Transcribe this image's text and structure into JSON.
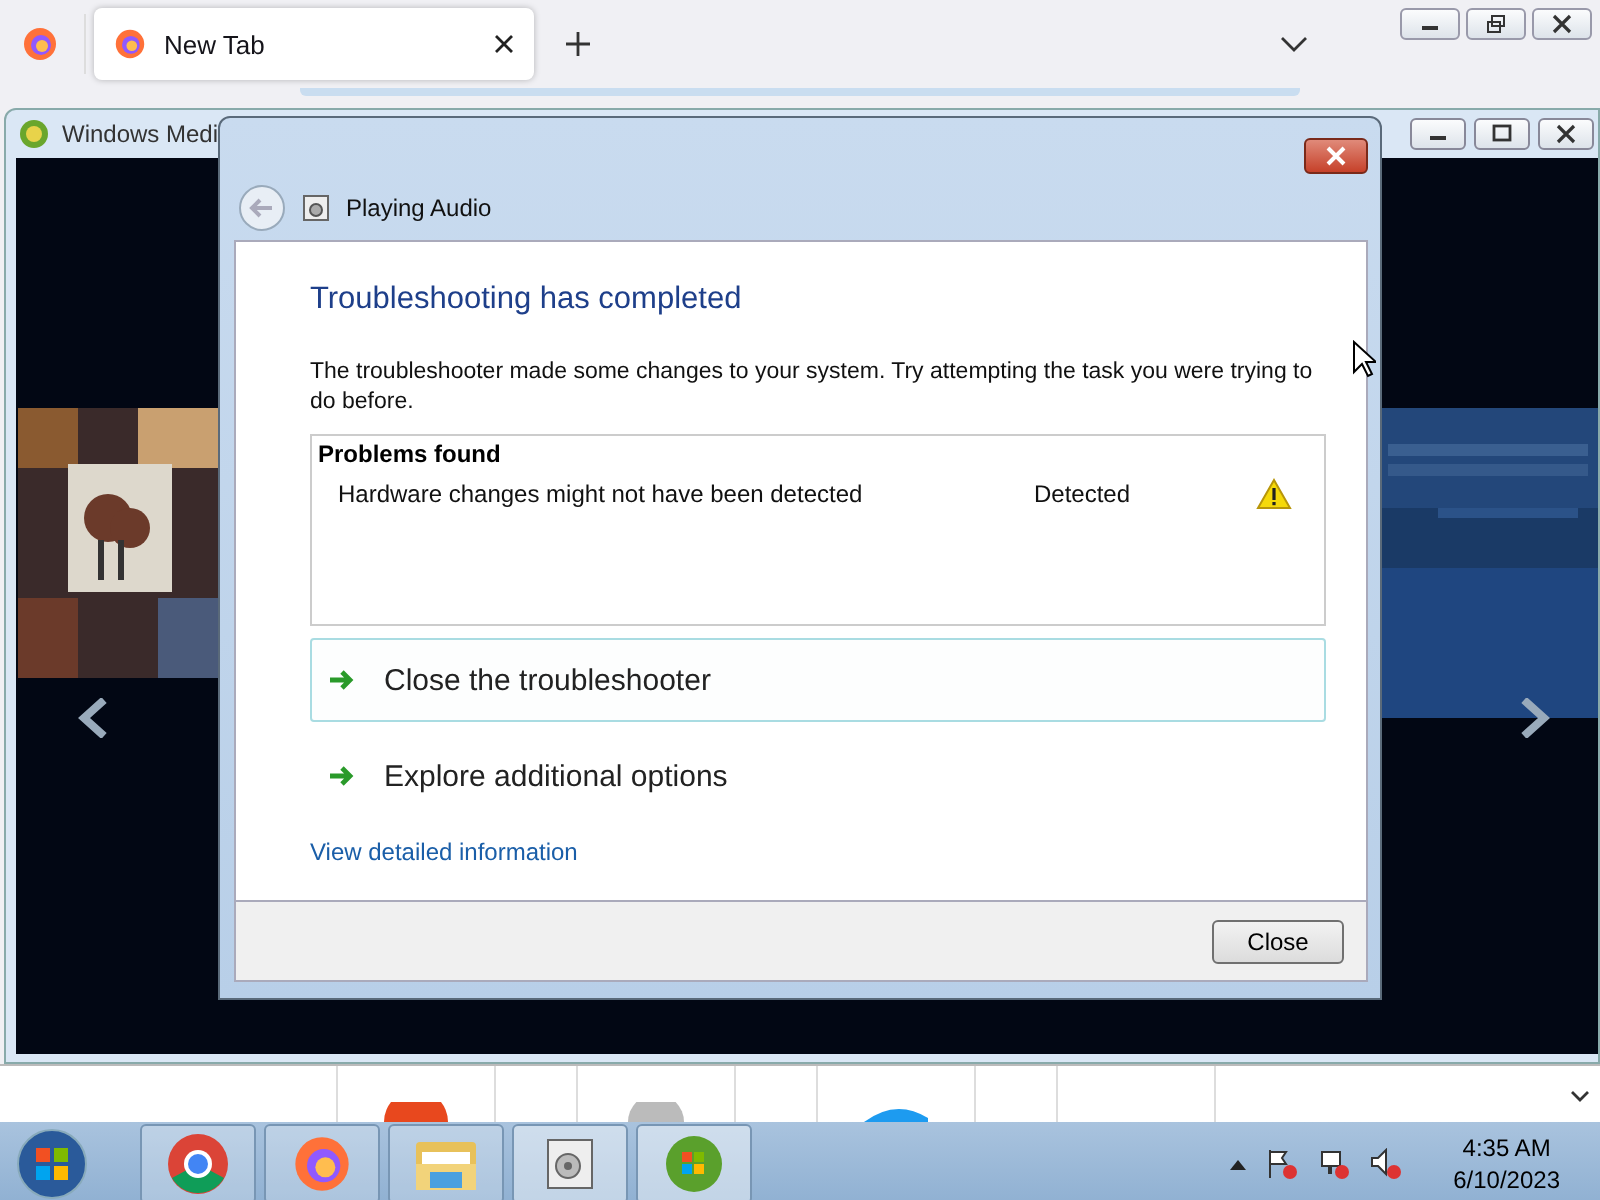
{
  "browser": {
    "tabs": [
      {
        "title": "New Tab",
        "selected": true
      }
    ]
  },
  "media_player": {
    "title": "Windows Medi"
  },
  "dialog": {
    "title": "Playing Audio",
    "heading": "Troubleshooting has completed",
    "message": "The troubleshooter made some changes to your system. Try attempting the task you were trying to do before.",
    "problems": {
      "heading": "Problems found",
      "rows": [
        {
          "problem": "Hardware changes might not have been detected",
          "status": "Detected"
        }
      ]
    },
    "options": [
      {
        "label": "Close the troubleshooter",
        "selected": true
      },
      {
        "label": "Explore additional options",
        "selected": false
      }
    ],
    "link": "View detailed information",
    "buttons": [
      "Close"
    ]
  },
  "clock": {
    "time": "4:35 AM",
    "date": "6/10/2023"
  }
}
